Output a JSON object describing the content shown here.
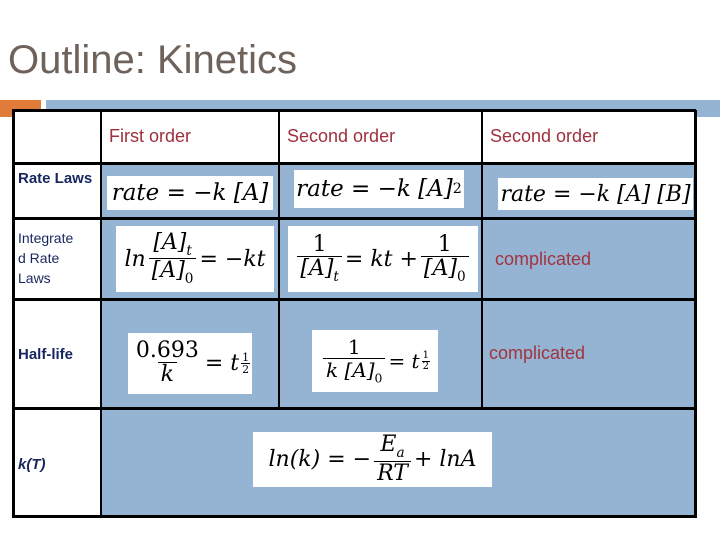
{
  "slide": {
    "title": "Outline: Kinetics",
    "accent_colors": {
      "orange": "#e07b39",
      "blue": "#95b3d2"
    }
  },
  "table": {
    "columns": [
      "",
      "First order",
      "Second order",
      "Second order"
    ],
    "rows": [
      {
        "label": "Rate Laws",
        "cells": [
          "rate = −k [A]",
          "rate = −k [A]^2",
          "rate = −k [A] [B]"
        ]
      },
      {
        "label": "Integrated Rate Laws",
        "label_display": [
          "Integrate",
          "d Rate",
          "Laws"
        ],
        "cells": [
          "ln [A]_t / [A]_0 = −kt",
          "1/[A]_t = kt + 1/[A]_0",
          "complicated"
        ]
      },
      {
        "label": "Half-life",
        "cells": [
          "0.693 / k = t_1/2",
          "1 / (k [A]_0) = t_1/2",
          "complicated"
        ]
      },
      {
        "label": "k(T)",
        "cells": [
          "ln(k) = −E_a / RT + lnA"
        ]
      }
    ],
    "colors": {
      "header_text": "#9e2f3c",
      "label_text": "#17275e",
      "cell_fill": "#95b3d2"
    }
  },
  "math": {
    "rate": "rate",
    "eq": "=",
    "minus_k": "−k",
    "A": "[A]",
    "B": "[B]",
    "two": "2",
    "ln": "ln",
    "At_base": "[A]",
    "t": "t",
    "zero": "0",
    "minus_kt": "= −kt",
    "one": "1",
    "kt_plus": "= kt +",
    "half_val": "0.693",
    "k": "k",
    "eq_t": "= t",
    "half_num": "1",
    "half_den": "2",
    "k_A": "k [A]",
    "lnk": "ln(k) = −",
    "Ea_base": "E",
    "Ea_sub": "a",
    "RT": "RT",
    "plus_lnA": "+ lnA"
  }
}
